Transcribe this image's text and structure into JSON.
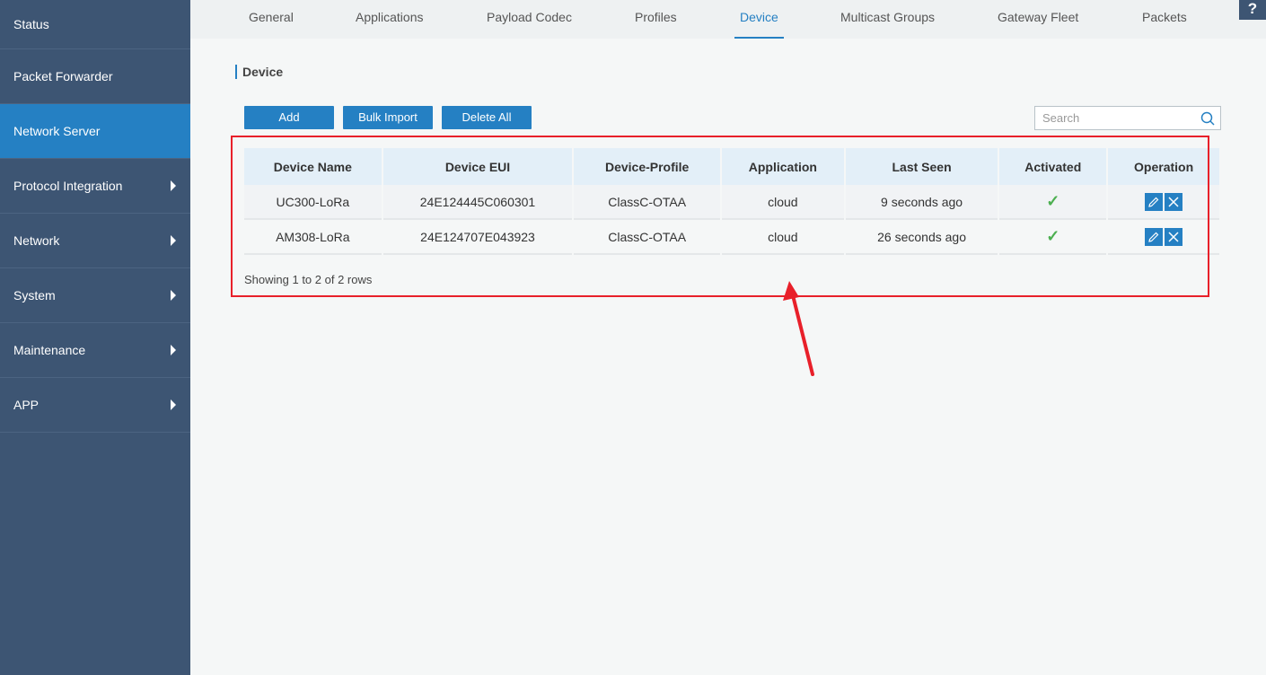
{
  "sidebar": {
    "items": [
      {
        "label": "Status",
        "has_submenu": false,
        "active": false
      },
      {
        "label": "Packet Forwarder",
        "has_submenu": false,
        "active": false
      },
      {
        "label": "Network Server",
        "has_submenu": false,
        "active": true
      },
      {
        "label": "Protocol Integration",
        "has_submenu": true,
        "active": false
      },
      {
        "label": "Network",
        "has_submenu": true,
        "active": false
      },
      {
        "label": "System",
        "has_submenu": true,
        "active": false
      },
      {
        "label": "Maintenance",
        "has_submenu": true,
        "active": false
      },
      {
        "label": "APP",
        "has_submenu": true,
        "active": false
      }
    ]
  },
  "tabs": [
    {
      "label": "General"
    },
    {
      "label": "Applications"
    },
    {
      "label": "Payload Codec"
    },
    {
      "label": "Profiles"
    },
    {
      "label": "Device",
      "active": true
    },
    {
      "label": "Multicast Groups"
    },
    {
      "label": "Gateway Fleet"
    },
    {
      "label": "Packets"
    }
  ],
  "help_label": "?",
  "section_title": "Device",
  "toolbar": {
    "add_label": "Add",
    "bulk_import_label": "Bulk Import",
    "delete_all_label": "Delete All"
  },
  "search": {
    "placeholder": "Search",
    "value": ""
  },
  "table": {
    "columns": [
      "Device Name",
      "Device EUI",
      "Device-Profile",
      "Application",
      "Last Seen",
      "Activated",
      "Operation"
    ],
    "rows": [
      {
        "name": "UC300-LoRa",
        "eui": "24E124445C060301",
        "profile": "ClassC-OTAA",
        "application": "cloud",
        "last_seen": "9 seconds ago",
        "activated": true
      },
      {
        "name": "AM308-LoRa",
        "eui": "24E124707E043923",
        "profile": "ClassC-OTAA",
        "application": "cloud",
        "last_seen": "26 seconds ago",
        "activated": true
      }
    ]
  },
  "pagination": {
    "summary": "Showing 1 to 2 of 2 rows"
  },
  "colors": {
    "sidebar_bg": "#3d5573",
    "accent": "#2580c3",
    "annotation_red": "#e8202a",
    "check_green": "#4caf50"
  }
}
